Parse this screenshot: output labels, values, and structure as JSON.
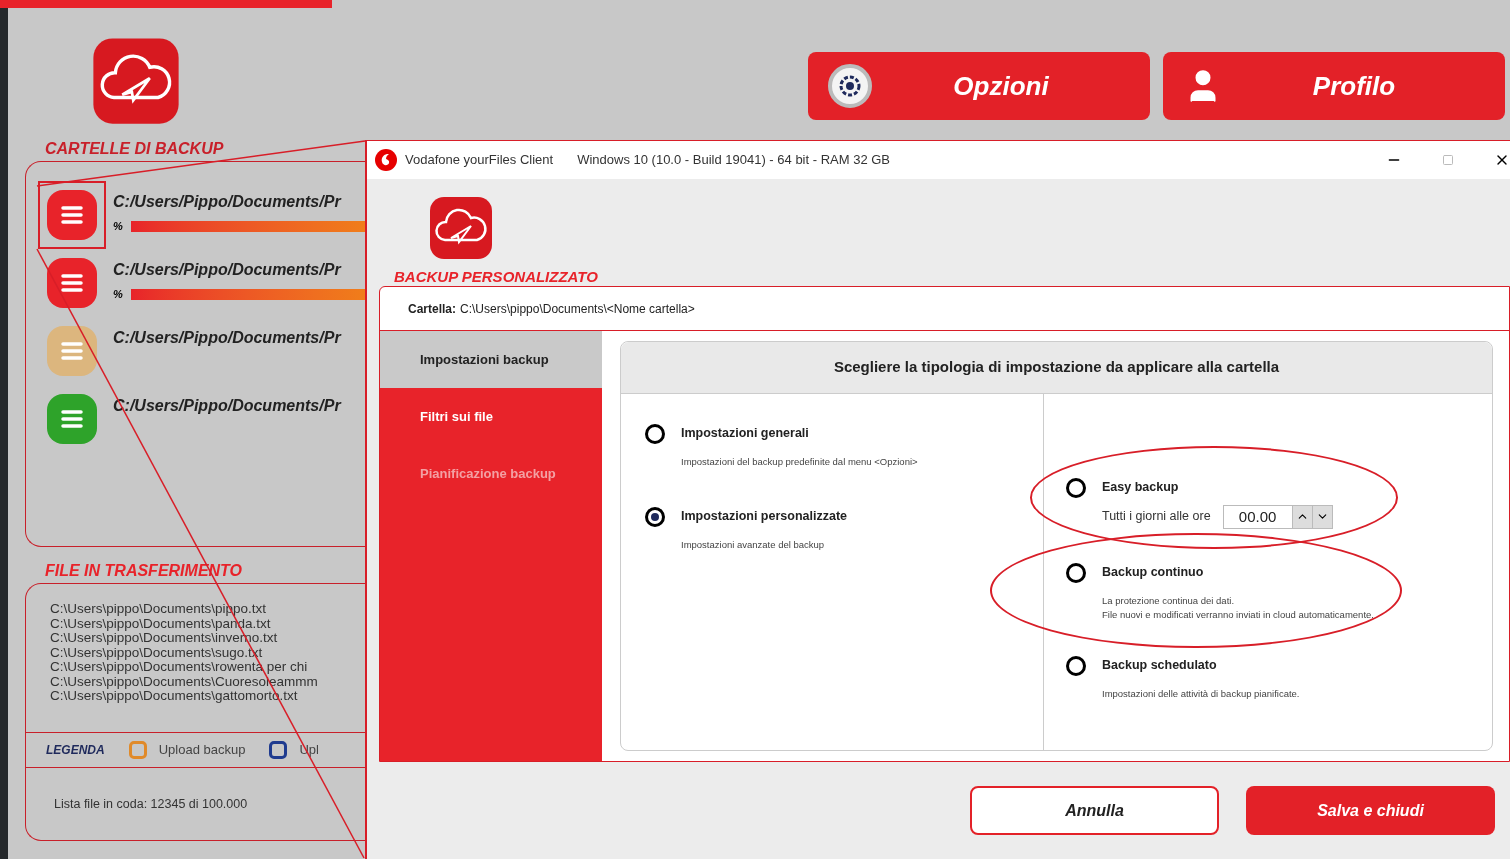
{
  "app": {
    "section_title": "CARTELLE DI BACKUP",
    "header_buttons": [
      {
        "label": "Opzioni",
        "kind": "options"
      },
      {
        "label": "Profilo",
        "kind": "profile"
      }
    ],
    "folders": [
      {
        "path": "C:/Users/Pippo/Documents/Pr",
        "color": "#e8232a",
        "selected": true,
        "progress": {
          "label": "%",
          "level": 1
        }
      },
      {
        "path": "C:/Users/Pippo/Documents/Pr",
        "color": "#e8232a",
        "selected": false,
        "progress": {
          "label": "%",
          "level": 1
        }
      },
      {
        "path": "C:/Users/Pippo/Documents/Pr",
        "color": "#dcb67e",
        "selected": false
      },
      {
        "path": "C:/Users/Pippo/Documents/Pr",
        "color": "#2ea32a",
        "selected": false
      }
    ],
    "transfer_title": "FILE IN TRASFERIMENTO",
    "transfer_files": [
      "C:\\Users\\pippo\\Documents\\pippo.txt",
      "C:\\Users\\pippo\\Documents\\panda.txt",
      "C:\\Users\\pippo\\Documents\\inverno.txt",
      "C:\\Users\\pippo\\Documents\\sugo.txt",
      "C:\\Users\\pippo\\Documents\\rowenta per chi",
      "C:\\Users\\pippo\\Documents\\Cuoresoleammm",
      "C:\\Users\\pippo\\Documents\\gattomorto.txt"
    ],
    "legend": {
      "title": "LEGENDA",
      "items": [
        {
          "label": "Upload backup",
          "color": "#e08a2a"
        },
        {
          "label": "Upl",
          "color": "#1f3b8f"
        }
      ]
    },
    "queue": "Lista file in coda: 12345 di 100.000"
  },
  "dialog": {
    "title": "Vodafone yourFiles Client",
    "system_info": "Windows 10 (10.0 - Build 19041) - 64 bit - RAM 32 GB",
    "heading": "BACKUP PERSONALIZZATO",
    "folder_label": "Cartella:",
    "folder_path": "C:\\Users\\pippo\\Documents\\<Nome cartella>",
    "nav": [
      {
        "label": "Impostazioni backup",
        "selected": true,
        "disabled": false
      },
      {
        "label": "Filtri sui file",
        "selected": false,
        "disabled": false
      },
      {
        "label": "Pianificazione backup",
        "selected": false,
        "disabled": true
      }
    ],
    "panel_title": "Scegliere la tipologia di impostazione da applicare alla cartella",
    "left_options": [
      {
        "label": "Impostazioni generali",
        "description": [
          "Impostazioni del backup predefinite dal menu <Opzioni>"
        ],
        "selected": false
      },
      {
        "label": "Impostazioni personalizzate",
        "description": [
          "Impostazioni avanzate del backup"
        ],
        "selected": true
      }
    ],
    "right_options": [
      {
        "kind": "time",
        "label": "Easy backup",
        "time_label": "Tutti i giorni alle ore",
        "time_value": "00.00",
        "selected": false,
        "annotated": true
      },
      {
        "kind": "text",
        "label": "Backup continuo",
        "description": [
          "La protezione continua dei dati.",
          "File nuovi e modificati verranno inviati in cloud automaticamente."
        ],
        "selected": false,
        "annotated": true
      },
      {
        "kind": "text",
        "label": "Backup schedulato",
        "description": [
          "Impostazioni delle attività di backup pianificate."
        ],
        "selected": false,
        "annotated": false
      }
    ],
    "buttons": [
      {
        "label": "Annulla",
        "kind": "secondary"
      },
      {
        "label": "Salva e chiudi",
        "kind": "primary"
      }
    ]
  }
}
